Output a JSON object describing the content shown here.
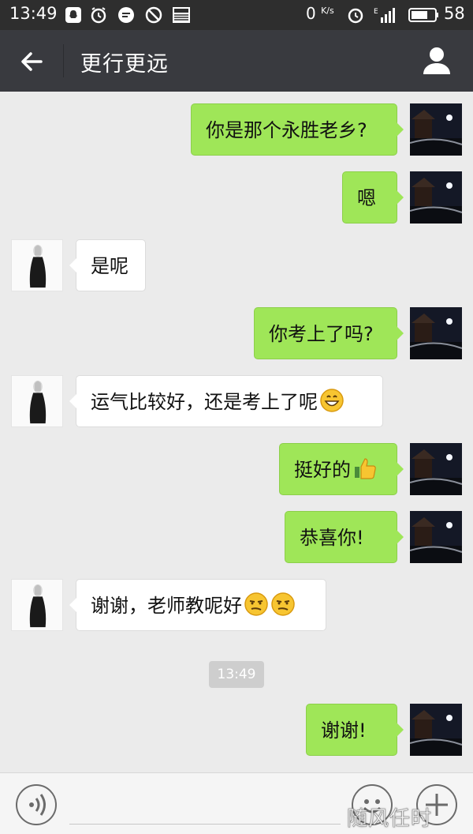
{
  "status_bar": {
    "time": "13:49",
    "net_speed": "0",
    "net_speed_unit": "K/s",
    "signal_label": "E",
    "battery": "58"
  },
  "title_bar": {
    "title": "更行更远"
  },
  "messages": [
    {
      "side": "sent",
      "text": "你是那个永胜老乡?"
    },
    {
      "side": "sent",
      "text": "嗯"
    },
    {
      "side": "received",
      "text": "是呢"
    },
    {
      "side": "sent",
      "text": "你考上了吗?"
    },
    {
      "side": "received",
      "text": "运气比较好，还是考上了呢",
      "emoji": "grin-emoji"
    },
    {
      "side": "sent",
      "text": "挺好的",
      "emoji": "thumbs-up-emoji"
    },
    {
      "side": "sent",
      "text": "恭喜你!"
    },
    {
      "side": "received",
      "text": "谢谢，老师教呢好",
      "emoji": "smirk-emoji x2"
    },
    {
      "side": "sent",
      "text": "谢谢!"
    }
  ],
  "timestamp": "13:49",
  "bottom_bar": {
    "input_placeholder": ""
  },
  "watermark": "随风任时"
}
